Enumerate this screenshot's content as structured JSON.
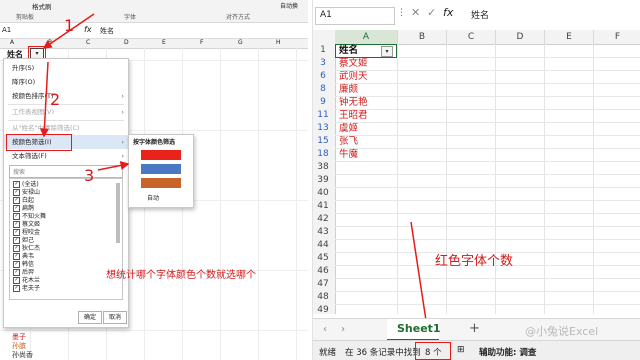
{
  "left": {
    "ribbon": {
      "format_painter": "格式刷",
      "clipboard": "剪贴板",
      "font": "字体",
      "alignment": "对齐方式",
      "overflow_right": "自动换"
    },
    "formula_bar": {
      "cell_ref": "A1",
      "fx": "fx",
      "value": "姓名"
    },
    "col_letters": [
      "A",
      "B",
      "C",
      "D",
      "E",
      "F",
      "G",
      "H"
    ],
    "header_cell": "姓名",
    "menu": {
      "items": [
        {
          "label": "升序(S)",
          "disabled": false,
          "arrow": false
        },
        {
          "label": "降序(O)",
          "disabled": false,
          "arrow": false
        },
        {
          "label": "按颜色排序(T)",
          "disabled": false,
          "arrow": true
        },
        {
          "label": "工作表视图(V)",
          "disabled": true,
          "arrow": true
        },
        {
          "label": "从\"姓名\"中清除筛选(C)",
          "disabled": true,
          "arrow": false
        },
        {
          "label": "按颜色筛选(I)",
          "disabled": false,
          "arrow": true
        },
        {
          "label": "文本筛选(F)",
          "disabled": false,
          "arrow": true
        }
      ],
      "search_placeholder": "搜索",
      "checklist": [
        "(全选)",
        "安禄山",
        "白起",
        "扁鹊",
        "不知火舞",
        "蔡文姬",
        "程咬金",
        "妲己",
        "狄仁杰",
        "典韦",
        "韩信",
        "后羿",
        "花木兰",
        "老夫子"
      ],
      "ok": "确定",
      "cancel": "取消"
    },
    "submenu": {
      "title": "按字体颜色筛选",
      "colors": [
        "#e8231b",
        "#4a79c2",
        "#c7642a"
      ],
      "auto": "自动"
    },
    "step_labels": [
      "1",
      "2",
      "3"
    ],
    "annotation": "想统计哪个字体颜色个数就选哪个",
    "bottom_rows": [
      {
        "num": "",
        "name": "墨子"
      },
      {
        "num": "",
        "name": "孙膑"
      },
      {
        "num": "",
        "name": "孙尚香"
      }
    ]
  },
  "right": {
    "formula_bar": {
      "cell_ref": "A1",
      "fx": "fx",
      "value": "姓名"
    },
    "columns": [
      "A",
      "B",
      "C",
      "D",
      "E",
      "F"
    ],
    "rows": [
      {
        "num": "1",
        "name": "姓名",
        "header": true
      },
      {
        "num": "3",
        "name": "蔡文姬"
      },
      {
        "num": "6",
        "name": "武则天"
      },
      {
        "num": "8",
        "name": "廉颇"
      },
      {
        "num": "9",
        "name": "钟无艳"
      },
      {
        "num": "11",
        "name": "王昭君"
      },
      {
        "num": "13",
        "name": "虞姬"
      },
      {
        "num": "15",
        "name": "张飞"
      },
      {
        "num": "18",
        "name": "牛魔"
      },
      {
        "num": "38",
        "name": ""
      },
      {
        "num": "39",
        "name": ""
      },
      {
        "num": "40",
        "name": ""
      },
      {
        "num": "41",
        "name": ""
      },
      {
        "num": "42",
        "name": ""
      },
      {
        "num": "43",
        "name": ""
      },
      {
        "num": "44",
        "name": ""
      },
      {
        "num": "45",
        "name": ""
      },
      {
        "num": "46",
        "name": ""
      },
      {
        "num": "47",
        "name": ""
      },
      {
        "num": "48",
        "name": ""
      },
      {
        "num": "49",
        "name": ""
      }
    ],
    "annotation": "红色字体个数",
    "sheet_tab": "Sheet1",
    "add_sheet": "+",
    "status": {
      "ready": "就绪",
      "record_prefix": "在 36 条记录中找到",
      "record_count": "8 个",
      "accessibility": "辅助功能: 调查"
    },
    "watermark": "@小兔说Excel"
  }
}
